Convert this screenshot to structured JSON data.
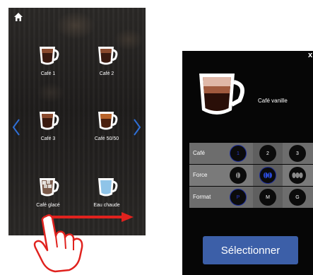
{
  "left_screen": {
    "drinks": [
      {
        "label": "Café 1"
      },
      {
        "label": "Café 2"
      },
      {
        "label": "Café 3"
      },
      {
        "label": "Café 50/50"
      },
      {
        "label": "Café glacé"
      },
      {
        "label": "Eau chaude"
      }
    ],
    "icons": {
      "home": "home-icon",
      "prev": "chevron-left-icon",
      "next": "chevron-right-icon",
      "swipe": "swipe-arrow-icon",
      "hand": "hand-pointer-icon"
    }
  },
  "right_screen": {
    "close_label": "x",
    "drink_name": "Café vanille",
    "options": [
      {
        "label": "Café",
        "values": [
          "1",
          "2",
          "3"
        ],
        "selected": 0
      },
      {
        "label": "Force",
        "values": [
          "",
          "",
          ""
        ],
        "selected": 1
      },
      {
        "label": "Format",
        "values": [
          "P",
          "M",
          "G"
        ],
        "selected": 0
      }
    ],
    "select_button": "Sélectionner"
  },
  "colors": {
    "accent_blue": "#3c5fa8",
    "swipe_red": "#e0221e",
    "chevron_blue": "#2f6fd6",
    "panel_dark": "#060606",
    "row_grey": "#6d6d6d"
  }
}
